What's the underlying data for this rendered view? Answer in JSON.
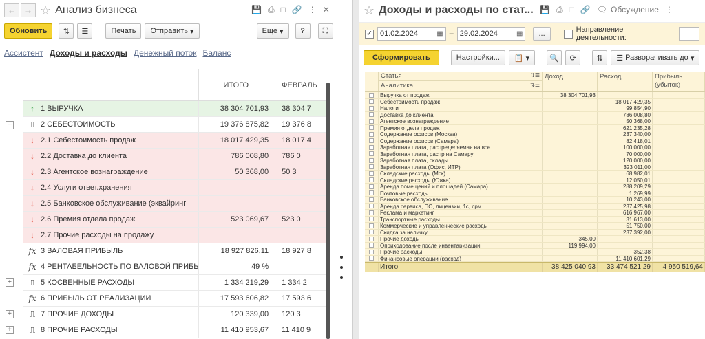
{
  "left": {
    "title": "Анализ бизнеса",
    "toolbar": {
      "refresh": "Обновить",
      "print": "Печать",
      "send": "Отправить",
      "more": "Еще",
      "help": "?"
    },
    "tabs": [
      "Ассистент",
      "Доходы и расходы",
      "Денежный поток",
      "Баланс"
    ],
    "columns": {
      "total": "ИТОГО",
      "february": "ФЕВРАЛЬ"
    },
    "rows": [
      {
        "label": "1  ВЫРУЧКА",
        "v1": "38 304 701,93",
        "v2": "38 304 7",
        "icon": "↑"
      },
      {
        "label": "2  СЕБЕСТОИМОСТЬ",
        "v1": "19 376 875,82",
        "v2": "19 376 8",
        "icon": "⎍"
      },
      {
        "label": "2.1  Себестоимость продаж",
        "v1": "18 017 429,35",
        "v2": "18 017 4",
        "icon": "↓"
      },
      {
        "label": "2.2  Доставка до клиента",
        "v1": "786 008,80",
        "v2": "786 0",
        "icon": "↓"
      },
      {
        "label": "2.3  Агентское вознаграждение",
        "v1": "50 368,00",
        "v2": "50 3",
        "icon": "↓"
      },
      {
        "label": "2.4  Услуги ответ.хранения",
        "v1": "",
        "v2": "",
        "icon": "↓"
      },
      {
        "label": "2.5  Банковское обслуживание (эквайринг",
        "v1": "",
        "v2": "",
        "icon": "↓"
      },
      {
        "label": "2.6  Премия отдела продаж",
        "v1": "523 069,67",
        "v2": "523 0",
        "icon": "↓"
      },
      {
        "label": "2.7  Прочие расходы на продажу",
        "v1": "",
        "v2": "",
        "icon": "↓"
      },
      {
        "label": "3  ВАЛОВАЯ ПРИБЫЛЬ",
        "v1": "18 927 826,11",
        "v2": "18 927 8",
        "icon": "fx"
      },
      {
        "label": "4  РЕНТАБЕЛЬНОСТЬ ПО ВАЛОВОЙ ПРИБЫ",
        "v1": "49 %",
        "v2": "",
        "icon": "fx"
      },
      {
        "label": "5  КОСВЕННЫЕ РАСХОДЫ",
        "v1": "1 334 219,29",
        "v2": "1 334 2",
        "icon": "⎍"
      },
      {
        "label": "6  ПРИБЫЛЬ ОТ РЕАЛИЗАЦИИ",
        "v1": "17 593 606,82",
        "v2": "17 593 6",
        "icon": "fx"
      },
      {
        "label": "7  ПРОЧИЕ ДОХОДЫ",
        "v1": "120 339,00",
        "v2": "120 3",
        "icon": "⎍"
      },
      {
        "label": "8  ПРОЧИЕ РАСХОДЫ",
        "v1": "11 410 953,67",
        "v2": "11 410 9",
        "icon": "⎍"
      }
    ]
  },
  "right": {
    "title": "Доходы и расходы по стат...",
    "discussion": "Обсуждение",
    "filters": {
      "date_from": "01.02.2024",
      "dash": "–",
      "date_to": "29.02.2024",
      "ellipsis": "...",
      "direction": "Направление деятельности:"
    },
    "toolbar": {
      "generate": "Сформировать",
      "settings": "Настройки...",
      "expand": "Разворачивать до"
    },
    "columns": {
      "item": "Статья",
      "analytics": "Аналитика",
      "income": "Доход",
      "expense": "Расход",
      "profit": "Прибыль (убыток)"
    },
    "rows": [
      {
        "name": "Выручка от продаж",
        "income": "38 304 701,93",
        "expense": "",
        "profit": ""
      },
      {
        "name": "Себестоимость продаж",
        "income": "",
        "expense": "18 017 429,35",
        "profit": ""
      },
      {
        "name": "Налоги",
        "income": "",
        "expense": "99 854,90",
        "profit": ""
      },
      {
        "name": "Доставка до клиента",
        "income": "",
        "expense": "786 008,80",
        "profit": ""
      },
      {
        "name": "Агентское вознаграждение",
        "income": "",
        "expense": "50 368,00",
        "profit": ""
      },
      {
        "name": "Премия отдела продаж",
        "income": "",
        "expense": "621 235,28",
        "profit": ""
      },
      {
        "name": "Содержание офисов (Москва)",
        "income": "",
        "expense": "237 340,00",
        "profit": ""
      },
      {
        "name": "Содержание офисов (Самара)",
        "income": "",
        "expense": "82 418,01",
        "profit": ""
      },
      {
        "name": "Заработная плата, распределяемая на все",
        "income": "",
        "expense": "100 000,00",
        "profit": ""
      },
      {
        "name": "Заработная плата, распр на Самару",
        "income": "",
        "expense": "70 000,00",
        "profit": ""
      },
      {
        "name": "Заработная плата, склады",
        "income": "",
        "expense": "120 000,00",
        "profit": ""
      },
      {
        "name": "Заработная плата (Офис, ИТР)",
        "income": "",
        "expense": "323 011,00",
        "profit": ""
      },
      {
        "name": "Складские расходы (Мск)",
        "income": "",
        "expense": "68 982,01",
        "profit": ""
      },
      {
        "name": "Складские расходы (Южка)",
        "income": "",
        "expense": "12 050,01",
        "profit": ""
      },
      {
        "name": "Аренда помещений и площадей (Самара)",
        "income": "",
        "expense": "288 209,29",
        "profit": ""
      },
      {
        "name": "Почтовые расходы",
        "income": "",
        "expense": "1 269,99",
        "profit": ""
      },
      {
        "name": "Банковское обслуживание",
        "income": "",
        "expense": "10 243,00",
        "profit": ""
      },
      {
        "name": "Аренда сервиса, ПО, лицензии, 1с, срм",
        "income": "",
        "expense": "237 425,98",
        "profit": ""
      },
      {
        "name": "Реклама и маркетинг",
        "income": "",
        "expense": "616 967,00",
        "profit": ""
      },
      {
        "name": "Транспортные расходы",
        "income": "",
        "expense": "31 613,00",
        "profit": ""
      },
      {
        "name": "Коммерческие и управленческие расходы",
        "income": "",
        "expense": "51 750,00",
        "profit": ""
      },
      {
        "name": "Скидка за наличку",
        "income": "",
        "expense": "237 392,00",
        "profit": ""
      },
      {
        "name": "Прочие доходы",
        "income": "345,00",
        "expense": "",
        "profit": ""
      },
      {
        "name": "Оприходование после инвентаризации",
        "income": "119 994,00",
        "expense": "",
        "profit": ""
      },
      {
        "name": "Прочие расходы",
        "income": "",
        "expense": "352,38",
        "profit": ""
      },
      {
        "name": "Финансовые операции (расход)",
        "income": "",
        "expense": "11 410 601,29",
        "profit": ""
      }
    ],
    "total": {
      "label": "Итого",
      "income": "38 425 040,93",
      "expense": "33 474 521,29",
      "profit": "4 950 519,64"
    }
  }
}
